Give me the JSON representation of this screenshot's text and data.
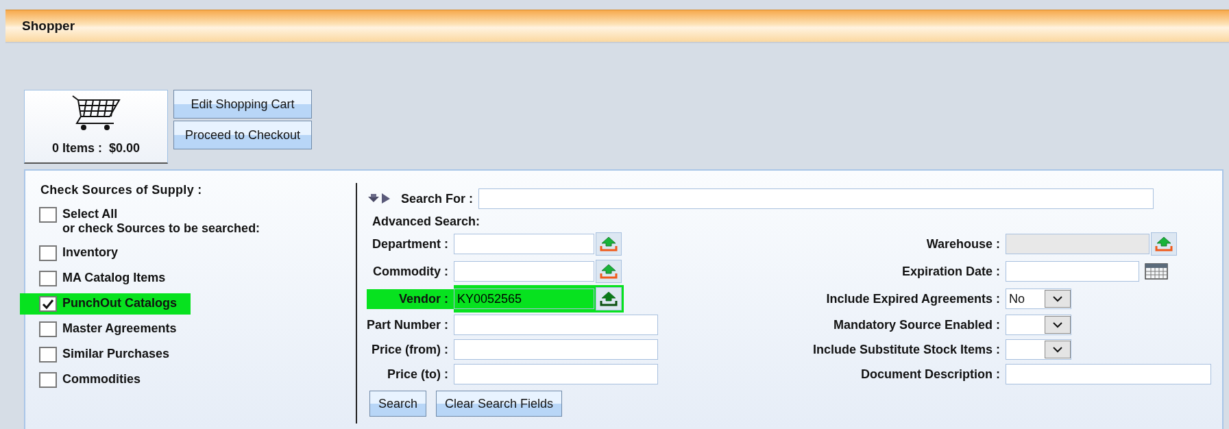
{
  "header": {
    "title": "Shopper"
  },
  "cart": {
    "summary": "0 Items :  $0.00",
    "buttons": [
      "Edit Shopping Cart",
      "Proceed to Checkout"
    ]
  },
  "sources": {
    "title": "Check Sources of Supply :",
    "select_all": {
      "label": "Select All",
      "hint": "or check Sources to be searched:",
      "checked": false
    },
    "items": [
      {
        "label": "Inventory",
        "checked": false,
        "highlighted": false
      },
      {
        "label": "MA Catalog Items",
        "checked": false,
        "highlighted": false
      },
      {
        "label": "PunchOut Catalogs",
        "checked": true,
        "highlighted": true
      },
      {
        "label": "Master Agreements",
        "checked": false,
        "highlighted": false
      },
      {
        "label": "Similar Purchases",
        "checked": false,
        "highlighted": false
      },
      {
        "label": "Commodities",
        "checked": false,
        "highlighted": false
      }
    ]
  },
  "search": {
    "label": "Search For :",
    "advanced_label": "Advanced Search:",
    "left_fields": [
      {
        "label": "Department :",
        "kind": "lookup",
        "disabled": false,
        "highlighted": false
      },
      {
        "label": "Commodity :",
        "kind": "lookup",
        "disabled": false,
        "highlighted": false
      },
      {
        "label": "Vendor :",
        "kind": "lookup",
        "value": "KY0052565",
        "disabled": false,
        "highlighted": true
      },
      {
        "label": "Part Number :",
        "kind": "text",
        "highlighted": false
      },
      {
        "label": "Price (from) :",
        "kind": "text",
        "highlighted": false
      },
      {
        "label": "Price (to) :",
        "kind": "text",
        "highlighted": false
      }
    ],
    "right_fields": [
      {
        "label": "Warehouse :",
        "kind": "lookup",
        "disabled": true,
        "highlighted": false
      },
      {
        "label": "Expiration Date :",
        "kind": "date",
        "highlighted": false
      },
      {
        "label": "Include Expired Agreements :",
        "kind": "select",
        "value": "No",
        "highlighted": false
      },
      {
        "label": "Mandatory Source Enabled :",
        "kind": "select",
        "highlighted": false
      },
      {
        "label": "Include Substitute Stock Items :",
        "kind": "select",
        "highlighted": false
      },
      {
        "label": "Document Description :",
        "kind": "wide",
        "highlighted": false
      }
    ],
    "buttons": [
      "Search",
      "Clear Search Fields"
    ]
  }
}
